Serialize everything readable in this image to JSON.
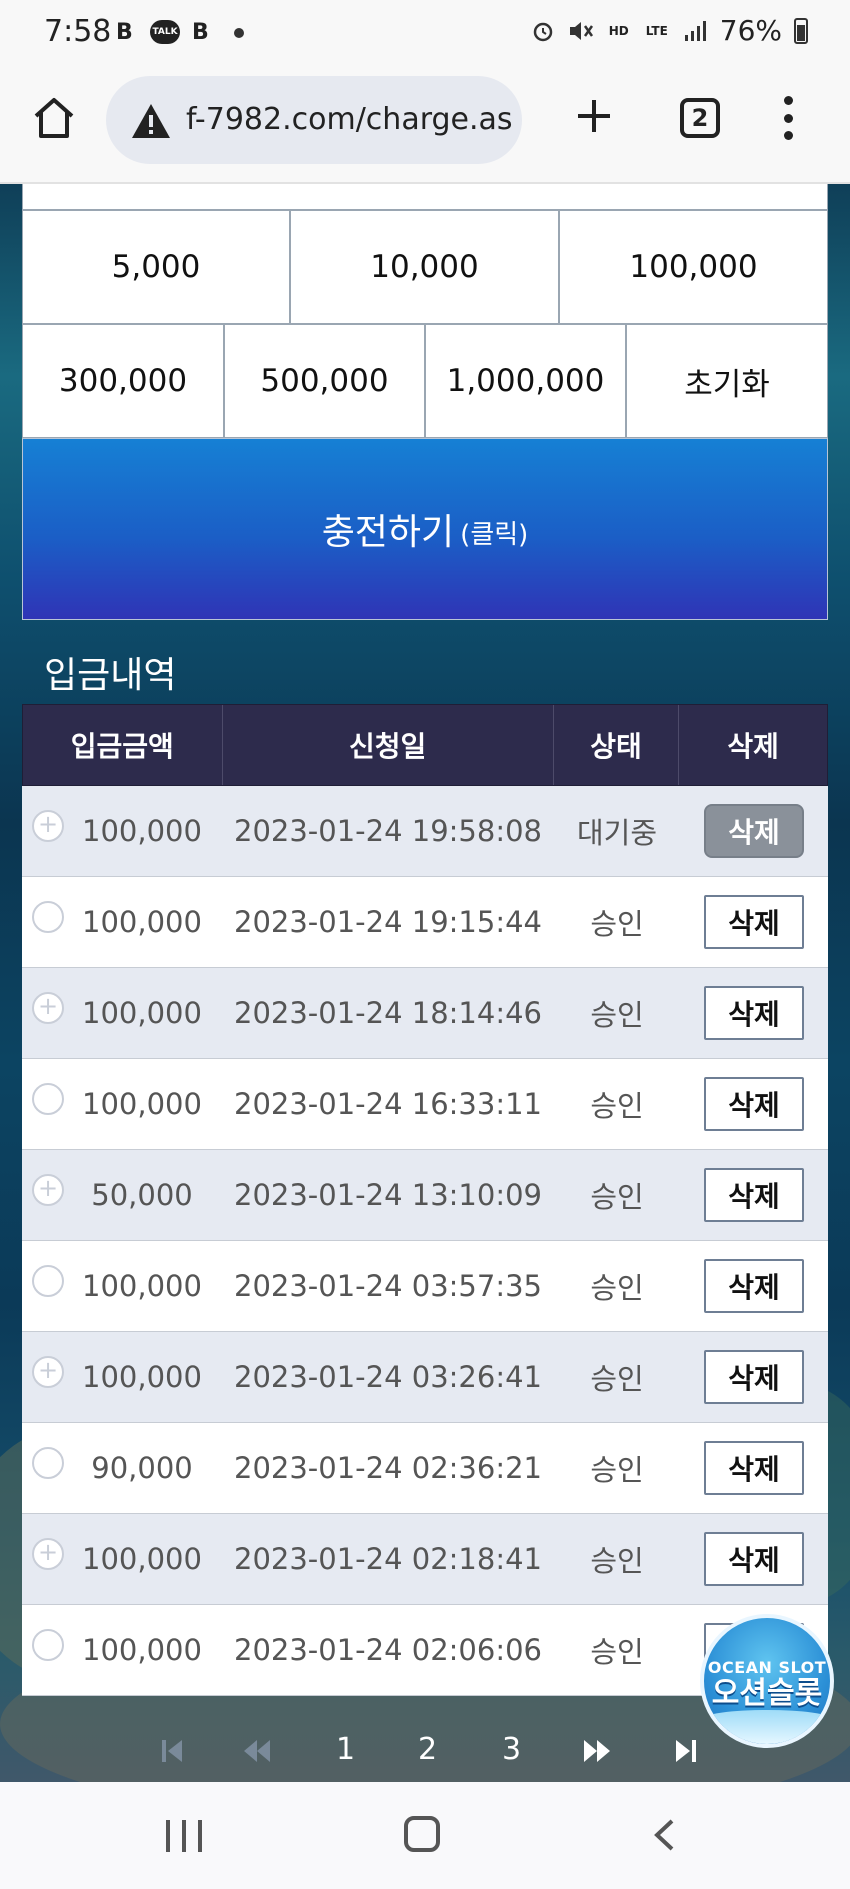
{
  "status_bar": {
    "time": "7:58",
    "apps": [
      "B",
      "TALK",
      "B"
    ],
    "network": "LTE",
    "battery": "76%"
  },
  "browser": {
    "url": "f-7982.com/charge.as",
    "tab_count": "2",
    "icons": [
      "home-icon",
      "warning-icon",
      "plus-icon",
      "tabs-icon",
      "more-vert-icon"
    ]
  },
  "amounts": {
    "row1": [
      "5,000",
      "10,000",
      "100,000"
    ],
    "row2": [
      "300,000",
      "500,000",
      "1,000,000"
    ],
    "reset_label": "초기화"
  },
  "charge": {
    "label": "충전하기",
    "sub_label": "(클릭)"
  },
  "history": {
    "title": "입금내역",
    "columns": [
      "입금금액",
      "신청일",
      "상태",
      "삭제"
    ],
    "rows": [
      {
        "amount": "100,000",
        "date": "2023-01-24 19:58:08",
        "status": "대기중",
        "action": "삭제"
      },
      {
        "amount": "100,000",
        "date": "2023-01-24 19:15:44",
        "status": "승인",
        "action": "삭제"
      },
      {
        "amount": "100,000",
        "date": "2023-01-24 18:14:46",
        "status": "승인",
        "action": "삭제"
      },
      {
        "amount": "100,000",
        "date": "2023-01-24 16:33:11",
        "status": "승인",
        "action": "삭제"
      },
      {
        "amount": "50,000",
        "date": "2023-01-24 13:10:09",
        "status": "승인",
        "action": "삭제"
      },
      {
        "amount": "100,000",
        "date": "2023-01-24 03:57:35",
        "status": "승인",
        "action": "삭제"
      },
      {
        "amount": "100,000",
        "date": "2023-01-24 03:26:41",
        "status": "승인",
        "action": "삭제"
      },
      {
        "amount": "90,000",
        "date": "2023-01-24 02:36:21",
        "status": "승인",
        "action": "삭제"
      },
      {
        "amount": "100,000",
        "date": "2023-01-24 02:18:41",
        "status": "승인",
        "action": "삭제"
      },
      {
        "amount": "100,000",
        "date": "2023-01-24 02:06:06",
        "status": "승인",
        "action": "삭제"
      }
    ]
  },
  "pagination": {
    "pages": [
      "1",
      "2",
      "3"
    ]
  },
  "logo": {
    "en": "OCEAN SLOT",
    "ko": "오션슬롯"
  },
  "colors": {
    "table_header": "#2d2b4c",
    "charge_button_top": "#1680d4",
    "charge_button_bottom": "#2f34b6",
    "row_alt": "#e6eaf2"
  }
}
